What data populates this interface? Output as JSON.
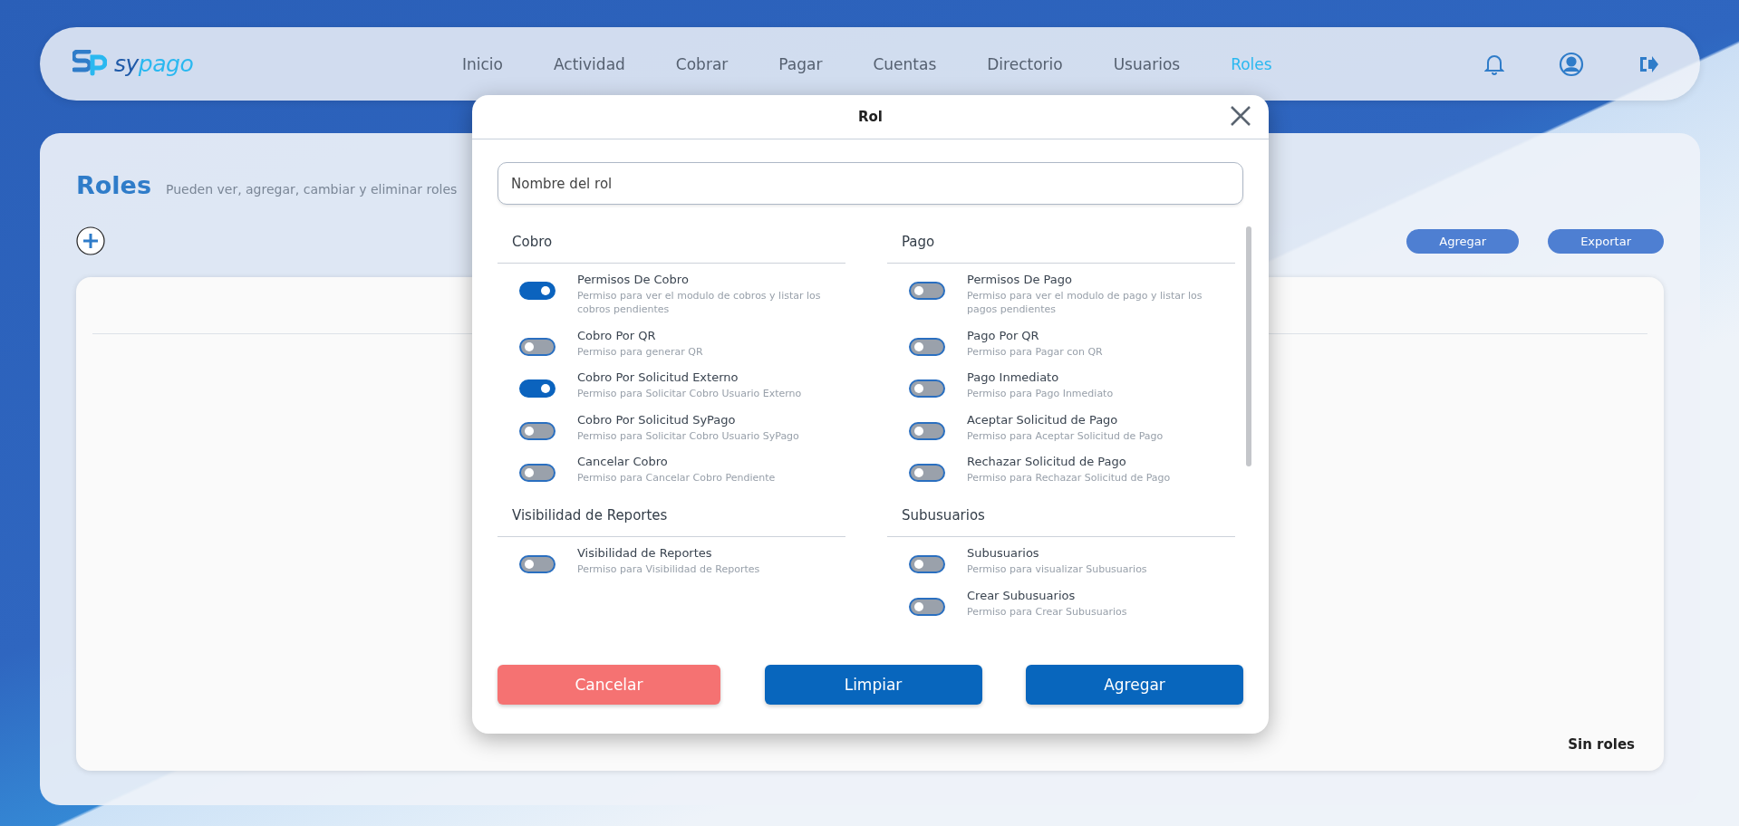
{
  "brand": {
    "part_1": "sy",
    "part_2": "pago"
  },
  "nav": [
    {
      "label": "Inicio",
      "selected": false
    },
    {
      "label": "Actividad",
      "selected": false
    },
    {
      "label": "Cobrar",
      "selected": false
    },
    {
      "label": "Pagar",
      "selected": false
    },
    {
      "label": "Cuentas",
      "selected": false
    },
    {
      "label": "Directorio",
      "selected": false
    },
    {
      "label": "Usuarios",
      "selected": false
    },
    {
      "label": "Roles",
      "selected": true
    }
  ],
  "page": {
    "title": "Roles",
    "subtitle": "Pueden ver, agregar, cambiar y eliminar roles",
    "buttons": [
      "Agregar",
      "Exportar"
    ],
    "empty_text": "Sin roles"
  },
  "modal": {
    "title": "Rol",
    "name_field": {
      "placeholder": "Nombre del rol"
    },
    "sections": [
      {
        "title": "Cobro",
        "permissions": [
          {
            "name": "Permisos De Cobro",
            "description": "Permiso para ver el modulo de cobros y listar los cobros pendientes",
            "on": true
          },
          {
            "name": "Cobro Por QR",
            "description": "Permiso para generar QR",
            "on": false
          },
          {
            "name": "Cobro Por Solicitud Externo",
            "description": "Permiso para Solicitar Cobro Usuario Externo",
            "on": true
          },
          {
            "name": "Cobro Por Solicitud SyPago",
            "description": "Permiso para Solicitar Cobro Usuario SyPago",
            "on": false
          },
          {
            "name": "Cancelar Cobro",
            "description": "Permiso para Cancelar Cobro Pendiente",
            "on": false
          }
        ]
      },
      {
        "title": "Pago",
        "permissions": [
          {
            "name": "Permisos De Pago",
            "description": "Permiso para ver el modulo de pago y listar los pagos pendientes",
            "on": false
          },
          {
            "name": "Pago Por QR",
            "description": "Permiso para Pagar con QR",
            "on": false
          },
          {
            "name": "Pago Inmediato",
            "description": "Permiso para Pago Inmediato",
            "on": false
          },
          {
            "name": "Aceptar Solicitud de Pago",
            "description": "Permiso para Aceptar Solicitud de Pago",
            "on": false
          },
          {
            "name": "Rechazar Solicitud de Pago",
            "description": "Permiso para Rechazar Solicitud de Pago",
            "on": false
          }
        ]
      },
      {
        "title": "Visibilidad de Reportes",
        "permissions": [
          {
            "name": "Visibilidad de Reportes",
            "description": "Permiso para Visibilidad de Reportes",
            "on": false
          }
        ]
      },
      {
        "title": "Subusuarios",
        "permissions": [
          {
            "name": "Subusuarios",
            "description": "Permiso para visualizar Subusuarios",
            "on": false
          },
          {
            "name": "Crear Subusuarios",
            "description": "Permiso para Crear Subusuarios",
            "on": false
          }
        ]
      }
    ],
    "buttons": [
      {
        "label": "Cancelar",
        "kind": "danger"
      },
      {
        "label": "Limpiar",
        "kind": "primary"
      },
      {
        "label": "Agregar",
        "kind": "primary"
      }
    ]
  }
}
